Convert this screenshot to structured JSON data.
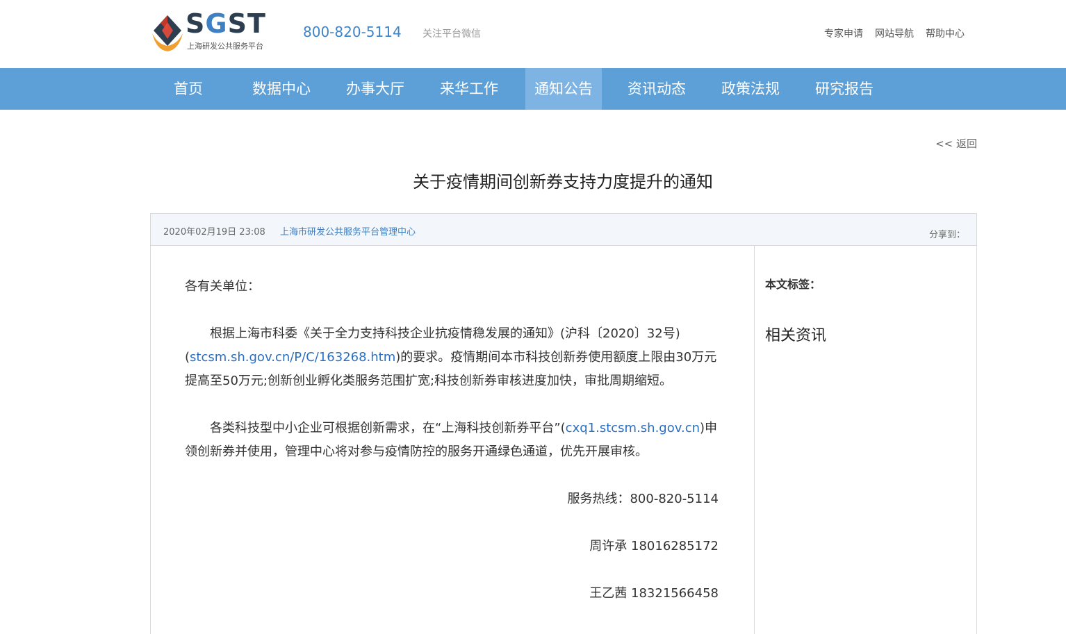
{
  "header": {
    "logo_text_s": "S",
    "logo_text_g": "G",
    "logo_text_st": "ST",
    "logo_subtitle": "上海研发公共服务平台",
    "hotline": "800-820-5114",
    "wechat": "关注平台微信",
    "links": [
      "专家申请",
      "网站导航",
      "帮助中心"
    ]
  },
  "nav": {
    "items": [
      "首页",
      "数据中心",
      "办事大厅",
      "来华工作",
      "通知公告",
      "资讯动态",
      "政策法规",
      "研究报告"
    ],
    "active": "通知公告"
  },
  "page": {
    "back": "<< 返回",
    "title": "关于疫情期间创新券支持力度提升的通知",
    "date": "2020年02月19日 23:08",
    "org": "上海市研发公共服务平台管理中心",
    "share": "分享到："
  },
  "article": {
    "greeting": "各有关单位：",
    "p1_a": "根据上海市科委《关于全力支持科技企业抗疫情稳发展的通知》(沪科〔2020〕32号)(",
    "p1_link": "stcsm.sh.gov.cn/P/C/163268.htm",
    "p1_b": ")的要求。疫情期间本市科技创新券使用额度上限由30万元提高至50万元;创新创业孵化类服务范围扩宽;科技创新券审核进度加快，审批周期缩短。",
    "p2_a": "各类科技型中小企业可根据创新需求，在“上海科技创新券平台”(",
    "p2_link": "cxq1.stcsm.sh.gov.cn",
    "p2_b": ")申领创新券并使用，管理中心将对参与疫情防控的服务开通绿色通道，优先开展审核。",
    "hotline_line": "服务热线：800-820-5114",
    "contact1": "周许承 18016285172",
    "contact2": "王乙茜 18321566458"
  },
  "sidebar": {
    "tags_label": "本文标签：",
    "related_label": "相关资讯"
  },
  "colors": {
    "nav_bg": "#5d9fd7",
    "nav_active": "#7db4e3",
    "link": "#2b6fc2",
    "hotline": "#3f84c6"
  }
}
